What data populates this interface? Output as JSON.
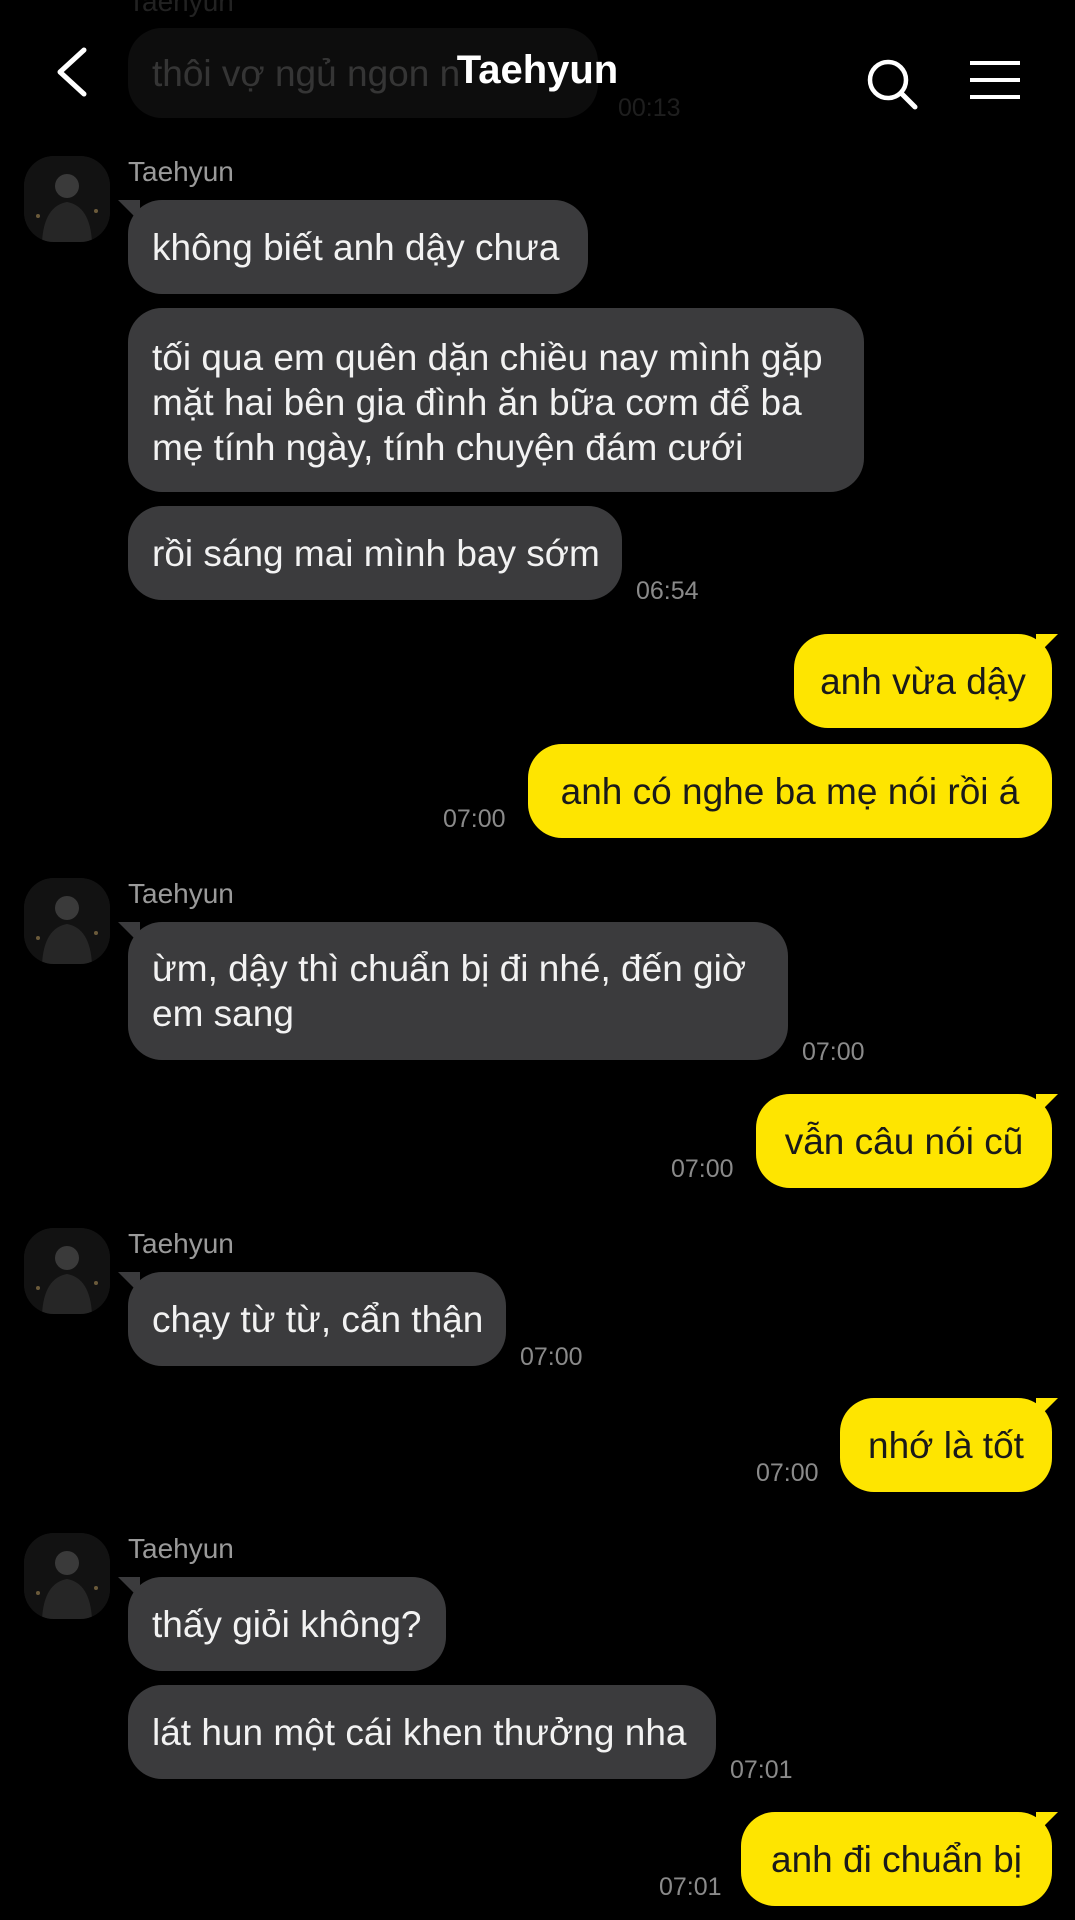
{
  "header": {
    "title": "Taehyun",
    "back_icon": "chevron-left-icon",
    "search_icon": "search-icon",
    "menu_icon": "menu-icon"
  },
  "colors": {
    "background": "#000000",
    "incoming_bubble": "#3b3b3d",
    "outgoing_bubble": "#fee500"
  },
  "faded_previous": {
    "sender": "Taehyun",
    "text": "thôi vợ ngủ ngon n",
    "time": "00:13"
  },
  "messages": [
    {
      "sender": "Taehyun",
      "text": "không biết anh dậy chưa"
    },
    {
      "text": "tối qua em quên dặn chiều nay mình gặp mặt hai bên gia đình ăn bữa cơm để ba mẹ tính ngày, tính chuyện đám cưới"
    },
    {
      "text": "rồi sáng mai mình bay sớm",
      "time": "06:54"
    },
    {
      "text": "anh vừa dậy"
    },
    {
      "text": "anh có nghe ba mẹ nói rồi á",
      "time": "07:00"
    },
    {
      "sender": "Taehyun",
      "text": "ừm, dậy thì chuẩn bị đi nhé, đến giờ em sang",
      "time": "07:00"
    },
    {
      "text": "vẫn câu nói cũ",
      "time": "07:00"
    },
    {
      "sender": "Taehyun",
      "text": "chạy từ từ, cẩn thận",
      "time": "07:00"
    },
    {
      "text": "nhớ là tốt",
      "time": "07:00"
    },
    {
      "sender": "Taehyun",
      "text": "thấy giỏi không?"
    },
    {
      "text": "lát hun một cái khen thưởng nha",
      "time": "07:01"
    },
    {
      "text": "anh đi chuẩn bị",
      "time": "07:01"
    }
  ]
}
